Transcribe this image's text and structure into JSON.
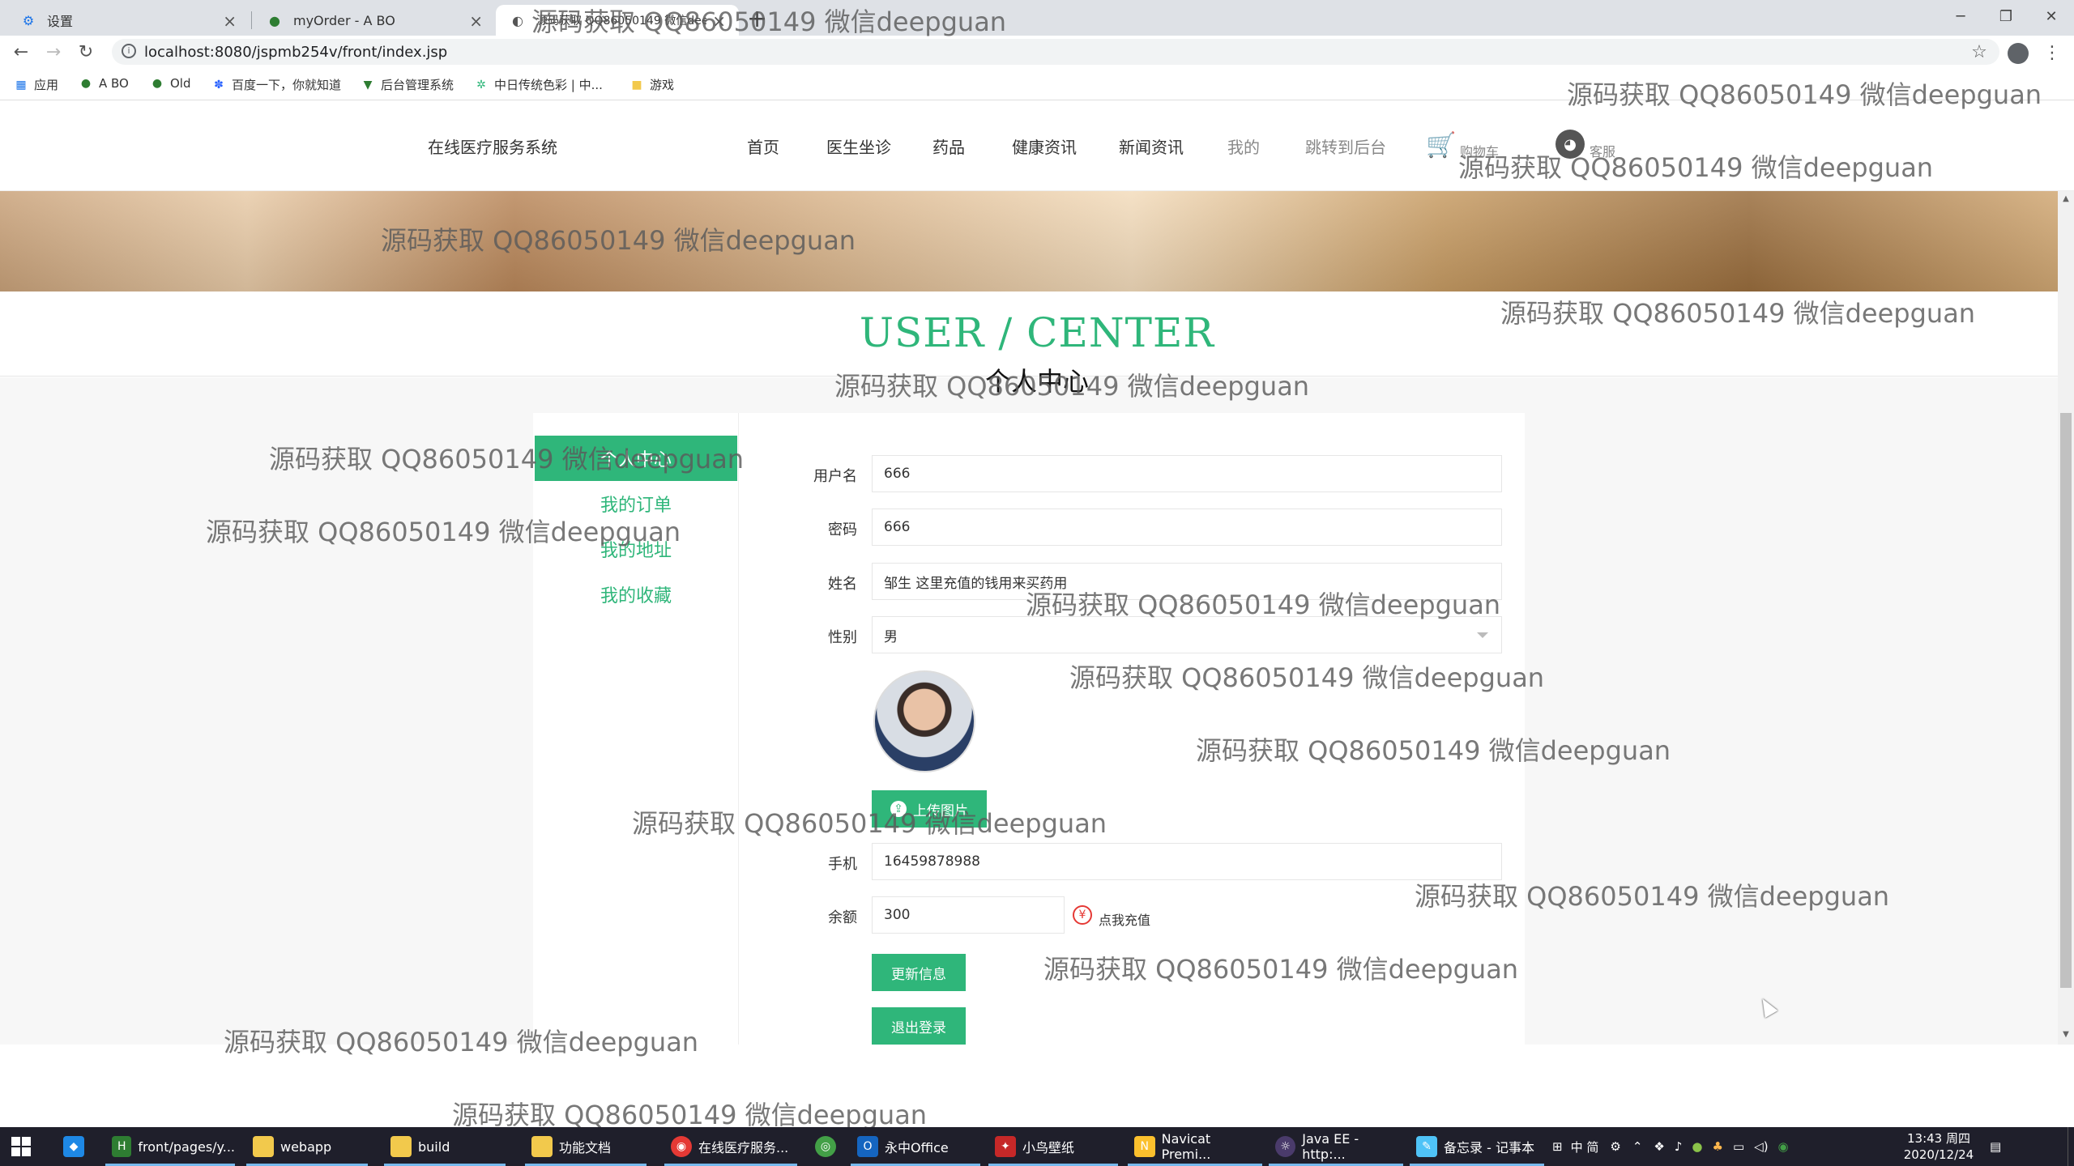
{
  "browser": {
    "tabs": [
      {
        "label": "设置",
        "icon": "gear-icon"
      },
      {
        "label": "myOrder - A BO",
        "icon": "leaf-icon"
      },
      {
        "label": "源码获取 QQ86050149 微信deepguan",
        "icon": "globe-icon"
      }
    ],
    "url": "localhost:8080/jspmb254v/front/index.jsp",
    "bookmarks": [
      {
        "label": "应用",
        "icon": "apps-grid-icon"
      },
      {
        "label": "A BO",
        "icon": "leaf-icon"
      },
      {
        "label": "Old",
        "icon": "leaf-icon"
      },
      {
        "label": "百度一下，你就知道",
        "icon": "paw-icon"
      },
      {
        "label": "后台管理系统",
        "icon": "vue-icon"
      },
      {
        "label": "中日传统色彩 | 中...",
        "icon": "color-icon"
      },
      {
        "label": "游戏",
        "icon": "folder-icon"
      }
    ]
  },
  "site": {
    "title": "在线医疗服务系统",
    "nav": [
      {
        "label": "首页"
      },
      {
        "label": "医生坐诊"
      },
      {
        "label": "药品"
      },
      {
        "label": "健康资讯"
      },
      {
        "label": "新闻资讯"
      },
      {
        "label": "我的"
      },
      {
        "label": "跳转到后台"
      }
    ],
    "cart_label": "购物车",
    "service_label": "客服"
  },
  "center": {
    "title_en": "USER / CENTER",
    "title_cn": "个人中心"
  },
  "sidebar": {
    "items": [
      {
        "label": "个人中心"
      },
      {
        "label": "我的订单"
      },
      {
        "label": "我的地址"
      },
      {
        "label": "我的收藏"
      }
    ]
  },
  "form": {
    "username_label": "用户名",
    "username": "666",
    "password_label": "密码",
    "password": "666",
    "name_label": "姓名",
    "name": "邹生 这里充值的钱用来买药用",
    "gender_label": "性别",
    "gender": "男",
    "upload_label": "上传图片",
    "phone_label": "手机",
    "phone": "16459878988",
    "balance_label": "余额",
    "balance": "300",
    "recharge_label": "点我充值",
    "update_label": "更新信息",
    "logout_label": "退出登录"
  },
  "watermark": "源码获取 QQ86050149 微信deepguan",
  "taskbar": {
    "items": [
      {
        "label": "front/pages/y...",
        "icon": "hbuilder-icon"
      },
      {
        "label": "webapp",
        "icon": "folder-icon"
      },
      {
        "label": "build",
        "icon": "folder-icon"
      },
      {
        "label": "功能文档",
        "icon": "folder-icon"
      },
      {
        "label": "在线医疗服务...",
        "icon": "chrome-icon"
      },
      {
        "label": "永中Office",
        "icon": "office-icon"
      },
      {
        "label": "小鸟壁纸",
        "icon": "bird-icon"
      },
      {
        "label": "Navicat Premi...",
        "icon": "navicat-icon"
      },
      {
        "label": "Java EE - http:...",
        "icon": "eclipse-icon"
      },
      {
        "label": "备忘录 - 记事本",
        "icon": "notepad-icon"
      }
    ],
    "tray_text": "中 简",
    "time": "13:43 周四",
    "date": "2020/12/24"
  },
  "colors": {
    "accent": "#2fb67a",
    "recharge": "#e53935"
  }
}
